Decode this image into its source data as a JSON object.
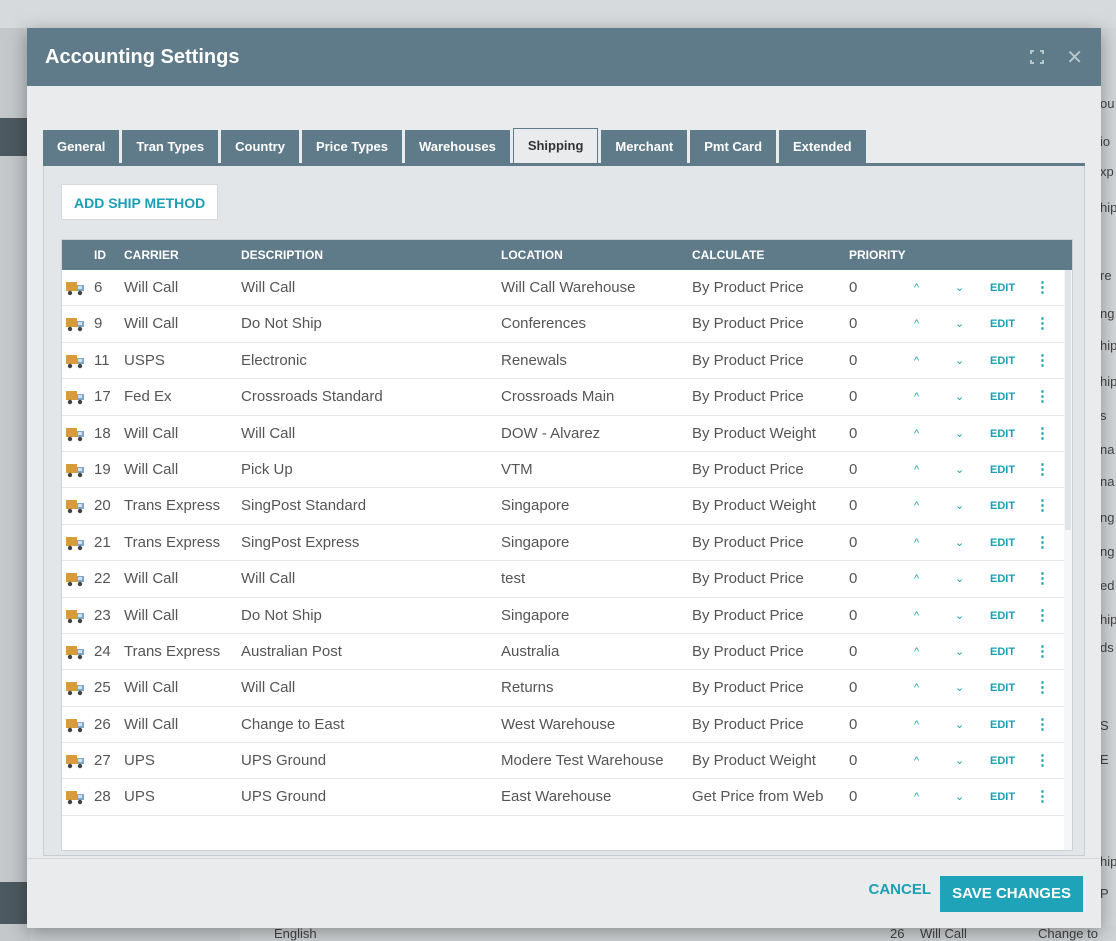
{
  "background": {
    "right_fragments": [
      "ou",
      "io",
      "xp",
      "hip",
      "re",
      "ng",
      "hip",
      "hip",
      "s",
      "na",
      "na",
      "ng",
      "ng",
      "ed",
      "hip",
      "ds",
      "S",
      "E",
      "hip",
      "P"
    ],
    "bottom_text": {
      "left": "English",
      "id": "26",
      "carrier": "Will Call",
      "desc": "Change to"
    }
  },
  "modal": {
    "title": "Accounting Settings",
    "tabs": [
      "General",
      "Tran Types",
      "Country",
      "Price Types",
      "Warehouses",
      "Shipping",
      "Merchant",
      "Pmt Card",
      "Extended"
    ],
    "active_tab": "Shipping",
    "add_button": "ADD SHIP METHOD",
    "columns": {
      "id": "ID",
      "carrier": "CARRIER",
      "description": "DESCRIPTION",
      "location": "LOCATION",
      "calculate": "CALCULATE",
      "priority": "PRIORITY"
    },
    "row_actions": {
      "up": "^",
      "down": "⌄",
      "edit": "EDIT",
      "more": "⋮"
    },
    "rows": [
      {
        "id": "6",
        "carrier": "Will Call",
        "description": "Will Call",
        "location": "Will Call Warehouse",
        "calculate": "By Product Price",
        "priority": "0"
      },
      {
        "id": "9",
        "carrier": "Will Call",
        "description": "Do Not Ship",
        "location": "Conferences",
        "calculate": "By Product Price",
        "priority": "0"
      },
      {
        "id": "11",
        "carrier": "USPS",
        "description": "Electronic",
        "location": "Renewals",
        "calculate": "By Product Price",
        "priority": "0"
      },
      {
        "id": "17",
        "carrier": "Fed Ex",
        "description": "Crossroads Standard",
        "location": "Crossroads Main",
        "calculate": "By Product Price",
        "priority": "0"
      },
      {
        "id": "18",
        "carrier": "Will Call",
        "description": "Will Call",
        "location": "DOW - Alvarez",
        "calculate": "By Product Weight",
        "priority": "0"
      },
      {
        "id": "19",
        "carrier": "Will Call",
        "description": "Pick Up",
        "location": "VTM",
        "calculate": "By Product Price",
        "priority": "0"
      },
      {
        "id": "20",
        "carrier": "Trans Express",
        "description": "SingPost Standard",
        "location": "Singapore",
        "calculate": "By Product Weight",
        "priority": "0"
      },
      {
        "id": "21",
        "carrier": "Trans Express",
        "description": "SingPost Express",
        "location": "Singapore",
        "calculate": "By Product Price",
        "priority": "0"
      },
      {
        "id": "22",
        "carrier": "Will Call",
        "description": "Will Call",
        "location": "test",
        "calculate": "By Product Price",
        "priority": "0"
      },
      {
        "id": "23",
        "carrier": "Will Call",
        "description": "Do Not Ship",
        "location": "Singapore",
        "calculate": "By Product Price",
        "priority": "0"
      },
      {
        "id": "24",
        "carrier": "Trans Express",
        "description": "Australian Post",
        "location": "Australia",
        "calculate": "By Product Price",
        "priority": "0"
      },
      {
        "id": "25",
        "carrier": "Will Call",
        "description": "Will Call",
        "location": "Returns",
        "calculate": "By Product Price",
        "priority": "0"
      },
      {
        "id": "26",
        "carrier": "Will Call",
        "description": "Change to East",
        "location": "West Warehouse",
        "calculate": "By Product Price",
        "priority": "0"
      },
      {
        "id": "27",
        "carrier": "UPS",
        "description": "UPS Ground",
        "location": "Modere Test Warehouse",
        "calculate": "By Product Weight",
        "priority": "0"
      },
      {
        "id": "28",
        "carrier": "UPS",
        "description": "UPS Ground",
        "location": "East Warehouse",
        "calculate": "Get Price from Web",
        "priority": "0"
      }
    ],
    "cancel_button": "CANCEL",
    "save_button": "SAVE CHANGES",
    "icons": {
      "expand": "expand-icon",
      "close": "close-icon",
      "carrier": "truck-icon"
    },
    "colors": {
      "header": "#5f7a88",
      "accent": "#1ea3b8"
    }
  }
}
